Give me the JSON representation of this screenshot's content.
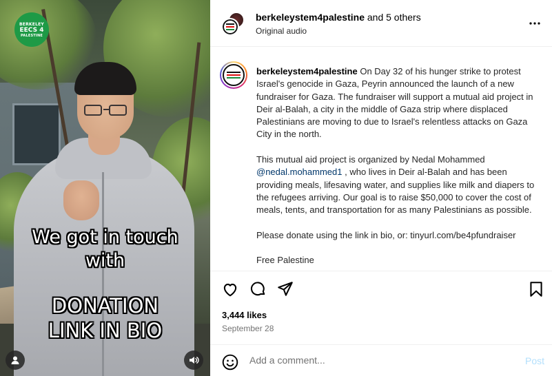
{
  "video": {
    "badge": {
      "line1": "BERKELEY",
      "line2": "EECS 4",
      "line3": "PALESTINE"
    },
    "caption_top": [
      "We got in touch",
      "with"
    ],
    "caption_bottom": [
      "DONATION",
      "LINK IN BIO"
    ],
    "user_icon": "user-icon",
    "audio_icon": "speaker-icon"
  },
  "header": {
    "username": "berkeleystem4palestine",
    "others": "and 5 others",
    "subtitle": "Original audio",
    "more_icon": "more-horizontal-icon"
  },
  "caption": {
    "username": "berkeleystem4palestine",
    "p1": "On Day 32 of his hunger strike to protest Israel's genocide in Gaza, Peyrin announced the launch of a new fundraiser for Gaza. The fundraiser will support a mutual aid project in Deir al-Balah, a city in the middle of Gaza strip where displaced Palestinians are moving to due to Israel's relentless attacks on Gaza City in the north.",
    "p2_before": "This mutual aid project is organized by Nedal Mohammed",
    "mention": "@nedal.mohammed1",
    "p2_after": ", who lives in Deir al-Balah and has been providing meals, lifesaving water, and supplies like milk and diapers to the refugees arriving. Our goal is to raise $50,000 to cover the cost of meals, tents, and transportation for as many Palestinians as possible.",
    "p3": "Please donate using the link in bio, or: tinyurl.com/be4pfundraiser",
    "p4": "Free Palestine"
  },
  "actions": {
    "like_icon": "heart-icon",
    "comment_icon": "comment-icon",
    "share_icon": "share-icon",
    "save_icon": "bookmark-icon"
  },
  "likes": "3,444 likes",
  "date": "September 28",
  "comment": {
    "placeholder": "Add a comment...",
    "post_label": "Post",
    "post_color": "#b2dffc"
  }
}
